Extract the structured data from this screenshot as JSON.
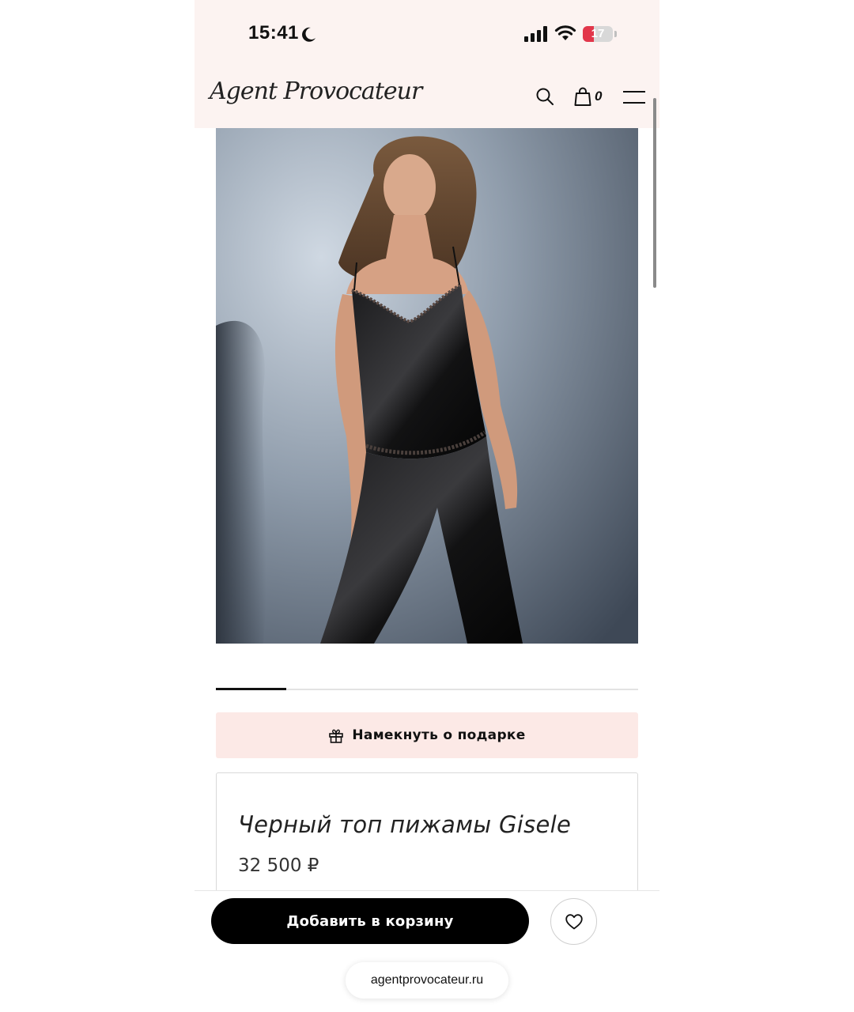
{
  "status_bar": {
    "time": "15:41",
    "battery_level": "17",
    "moon_icon": "moon-icon",
    "signal_icon": "cellular-signal-icon",
    "wifi_icon": "wifi-icon"
  },
  "header": {
    "logo_text": "Agent Provocateur",
    "cart_count": "0",
    "icons": [
      "search-icon",
      "shopping-bag-icon",
      "hamburger-menu-icon"
    ]
  },
  "product": {
    "image_alt": "product-photo",
    "title": "Черный топ пижамы Gisele",
    "price": "32 500 ₽",
    "carousel": {
      "current": 1,
      "total": 6
    }
  },
  "actions": {
    "gift_hint_label": "Намекнуть о подарке",
    "add_to_cart_label": "Добавить в корзину",
    "wishlist_icon": "heart-icon"
  },
  "browser": {
    "url": "agentprovocateur.ru"
  },
  "colors": {
    "header_bg": "#fcf3f1",
    "gift_button_bg": "#fce9e6",
    "primary_button_bg": "#000000",
    "battery_low": "#e2364a"
  }
}
